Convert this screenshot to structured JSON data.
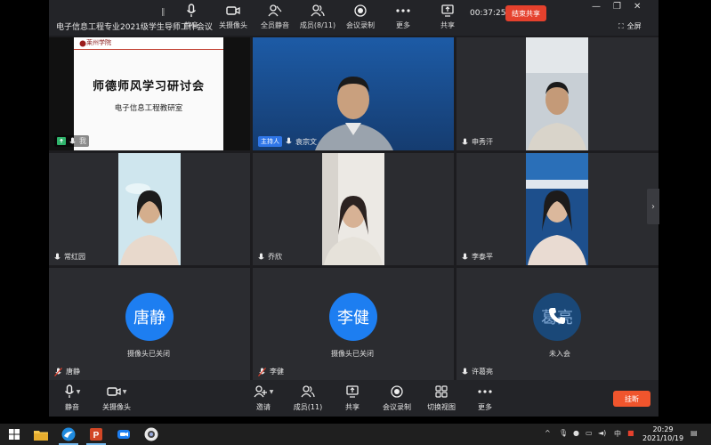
{
  "meeting": {
    "title": "电子信息工程专业2021级学生导师工作会议",
    "timer": "00:37:25",
    "end_share_label": "结束共享",
    "fullscreen_label": "全屏"
  },
  "top_controls": [
    {
      "key": "mute",
      "label": "静音",
      "icon": "microphone-icon"
    },
    {
      "key": "camera",
      "label": "关摄像头",
      "icon": "camera-icon"
    },
    {
      "key": "mute_all",
      "label": "全员静音",
      "icon": "mute-all-icon"
    },
    {
      "key": "members",
      "label": "成员(8/11)",
      "icon": "members-icon"
    },
    {
      "key": "record",
      "label": "会议录制",
      "icon": "record-icon"
    },
    {
      "key": "more",
      "label": "更多",
      "icon": "more-icon"
    },
    {
      "key": "share",
      "label": "共享",
      "icon": "share-screen-icon"
    }
  ],
  "slide": {
    "school": "莱州学院",
    "title": "师德师风学习研讨会",
    "subtitle": "电子信息工程教研室"
  },
  "participants": [
    {
      "name": "我",
      "role": "",
      "mic": "on"
    },
    {
      "name": "袁宗文",
      "role": "主持人",
      "mic": "on"
    },
    {
      "name": "申秀汗",
      "role": "",
      "mic": "on"
    },
    {
      "name": "常红园",
      "role": "",
      "mic": "on"
    },
    {
      "name": "乔欣",
      "role": "",
      "mic": "on"
    },
    {
      "name": "李泰平",
      "role": "",
      "mic": "on"
    },
    {
      "name": "唐静",
      "avatar_text": "唐静",
      "status": "摄像头已关闭",
      "mic": "muted"
    },
    {
      "name": "李健",
      "avatar_text": "李健",
      "status": "摄像头已关闭",
      "mic": "muted"
    },
    {
      "name": "许葛亮",
      "avatar_text": "葛亮",
      "status": "未入会",
      "mic": "on"
    }
  ],
  "bottom_controls": [
    {
      "key": "mute",
      "label": "静音",
      "icon": "microphone-icon"
    },
    {
      "key": "camera",
      "label": "关摄像头",
      "icon": "camera-icon"
    },
    {
      "key": "invite",
      "label": "邀请",
      "icon": "invite-icon"
    },
    {
      "key": "members",
      "label": "成员(11)",
      "icon": "members-icon"
    },
    {
      "key": "share",
      "label": "共享",
      "icon": "share-screen-icon"
    },
    {
      "key": "record",
      "label": "会议录制",
      "icon": "record-icon"
    },
    {
      "key": "switch_view",
      "label": "切换视图",
      "icon": "grid-view-icon"
    },
    {
      "key": "more",
      "label": "更多",
      "icon": "more-icon"
    }
  ],
  "hangup_label": "挂断",
  "taskbar": {
    "time": "20:29",
    "date": "2021/10/19",
    "ime": "中",
    "apps": [
      "file-explorer-icon",
      "browser-icon",
      "powerpoint-icon",
      "meeting-app-icon",
      "camera-app-icon"
    ]
  },
  "colors": {
    "accent_blue": "#1d7ef1",
    "end_red": "#e5412d",
    "hangup_orange": "#f0552d",
    "host_badge": "#2f76e8",
    "toolbar_bg": "#232428",
    "tile_bg": "#2b2c30"
  }
}
